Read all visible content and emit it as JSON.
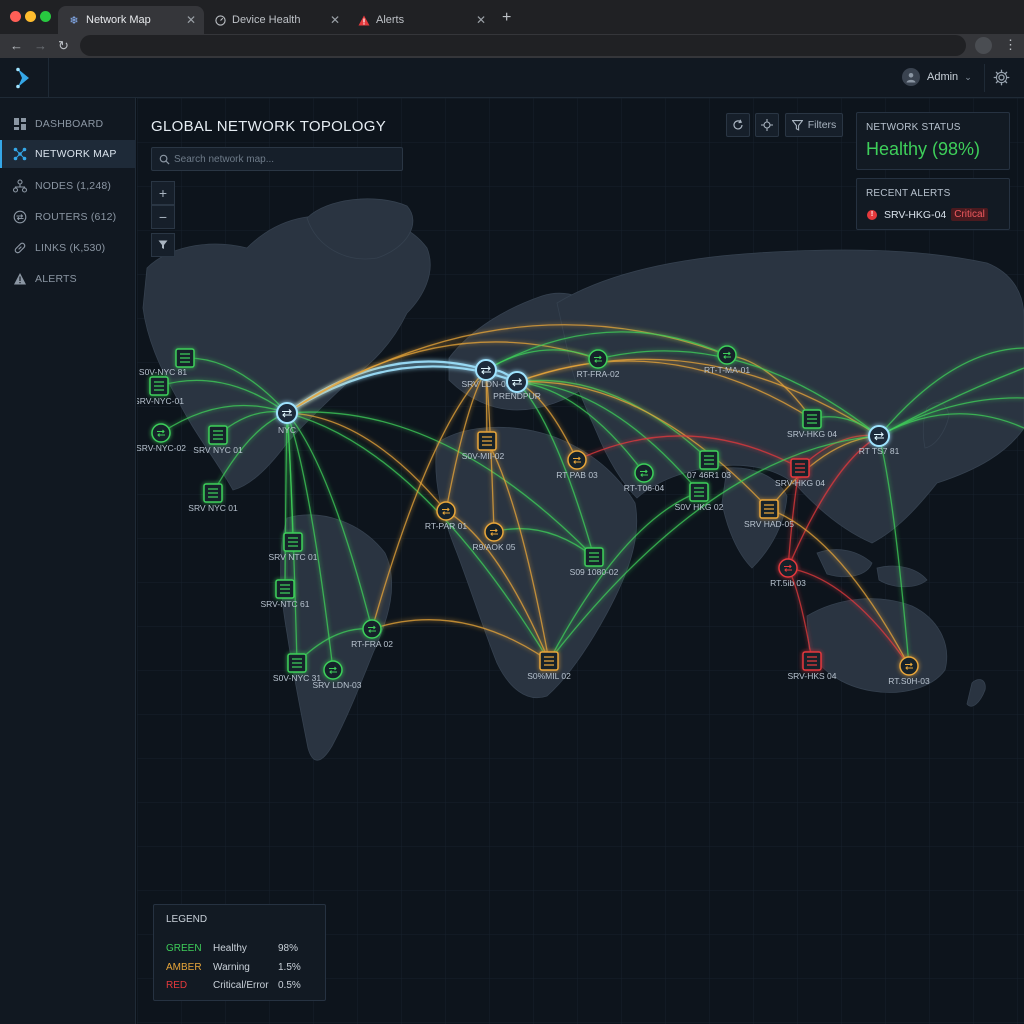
{
  "browser": {
    "tabs": [
      {
        "label": "Network Map",
        "icon": "snowflake-icon",
        "active": true
      },
      {
        "label": "Device Health",
        "icon": "gauge-icon",
        "active": false
      },
      {
        "label": "Alerts",
        "icon": "warning-icon",
        "active": false
      }
    ]
  },
  "header": {
    "user_name": "Admin"
  },
  "sidebar": {
    "items": [
      {
        "label": "DASHBOARD",
        "icon": "dashboard-icon"
      },
      {
        "label": "NETWORK MAP",
        "icon": "network-icon",
        "active": true
      },
      {
        "label": "NODES (1,248)",
        "icon": "nodes-icon"
      },
      {
        "label": "ROUTERS (612)",
        "icon": "router-icon"
      },
      {
        "label": "LINKS (K,530)",
        "icon": "link-icon"
      },
      {
        "label": "ALERTS",
        "icon": "alert-icon"
      }
    ]
  },
  "main": {
    "title": "GLOBAL NETWORK TOPOLOGY",
    "search_placeholder": "Search network map...",
    "filters_label": "Filters",
    "zoom_in": "+",
    "zoom_out": "−"
  },
  "status_panel": {
    "title": "NETWORK STATUS",
    "value": "Healthy (98%)"
  },
  "alerts_panel": {
    "title": "RECENT ALERTS",
    "device": "SRV-HKG-04",
    "severity": "Critical"
  },
  "legend": {
    "title": "LEGEND",
    "rows": [
      {
        "color_name": "GREEN",
        "status": "Healthy",
        "pct": "98%",
        "color": "#3ecf5a"
      },
      {
        "color_name": "AMBER",
        "status": "Warning",
        "pct": "1.5%",
        "color": "#e8a63a"
      },
      {
        "color_name": "RED",
        "status": "Critical/Error",
        "pct": "0.5%",
        "color": "#e5393c"
      }
    ]
  },
  "colors": {
    "healthy": "#3ecf5a",
    "warning": "#e8a63a",
    "critical": "#e5393c",
    "hub": "#9fe3ff",
    "accent": "#35a7e8"
  },
  "map_nodes": [
    {
      "label": "S0V-NYC 81",
      "kind": "server",
      "status": "healthy"
    },
    {
      "label": "SRV-NYC-01",
      "kind": "server",
      "status": "healthy"
    },
    {
      "label": "SRV-NYC-02",
      "kind": "router",
      "status": "healthy"
    },
    {
      "label": "SRV NYC 01",
      "kind": "server",
      "status": "healthy"
    },
    {
      "label": "SRV NYC 01",
      "kind": "server",
      "status": "healthy"
    },
    {
      "label": "NYC",
      "kind": "hub",
      "status": "hub"
    },
    {
      "label": "SRV NTC 01",
      "kind": "server",
      "status": "healthy"
    },
    {
      "label": "SRV-NTC 61",
      "kind": "server",
      "status": "healthy"
    },
    {
      "label": "S0V-NYC 31",
      "kind": "server",
      "status": "healthy"
    },
    {
      "label": "SRV LDN-03",
      "kind": "router",
      "status": "healthy"
    },
    {
      "label": "RT-FRA 02",
      "kind": "router",
      "status": "healthy"
    },
    {
      "label": "SRV LDN-03",
      "kind": "hub",
      "status": "hub"
    },
    {
      "label": "PRENDPUR",
      "kind": "hub",
      "status": "hub"
    },
    {
      "label": "S0V-MII-02",
      "kind": "server",
      "status": "warning"
    },
    {
      "label": "RT-PAR 01",
      "kind": "router",
      "status": "warning"
    },
    {
      "label": "R9/AOK 05",
      "kind": "router",
      "status": "warning"
    },
    {
      "label": "RT-FRA-02",
      "kind": "router",
      "status": "healthy"
    },
    {
      "label": "RT PAB 03",
      "kind": "router",
      "status": "warning"
    },
    {
      "label": "RT-T-MA-01",
      "kind": "router",
      "status": "healthy"
    },
    {
      "label": "RT-T06-04",
      "kind": "router",
      "status": "healthy"
    },
    {
      "label": "07 46R1 03",
      "kind": "server",
      "status": "healthy"
    },
    {
      "label": "S0V HKG 02",
      "kind": "server",
      "status": "healthy"
    },
    {
      "label": "S09 1080-02",
      "kind": "server",
      "status": "healthy"
    },
    {
      "label": "S0%MIL 02",
      "kind": "server",
      "status": "warning"
    },
    {
      "label": "SRV-HKG 04",
      "kind": "server",
      "status": "healthy"
    },
    {
      "label": "SRV-HKG 04",
      "kind": "server",
      "status": "critical"
    },
    {
      "label": "SRV HAD-05",
      "kind": "server",
      "status": "warning"
    },
    {
      "label": "RT.5ib 03",
      "kind": "router",
      "status": "critical"
    },
    {
      "label": "RT TS7 81",
      "kind": "hub",
      "status": "hub"
    },
    {
      "label": "SRV-HKS 04",
      "kind": "server",
      "status": "critical"
    },
    {
      "label": "RT.S0H-03",
      "kind": "router",
      "status": "warning"
    }
  ]
}
